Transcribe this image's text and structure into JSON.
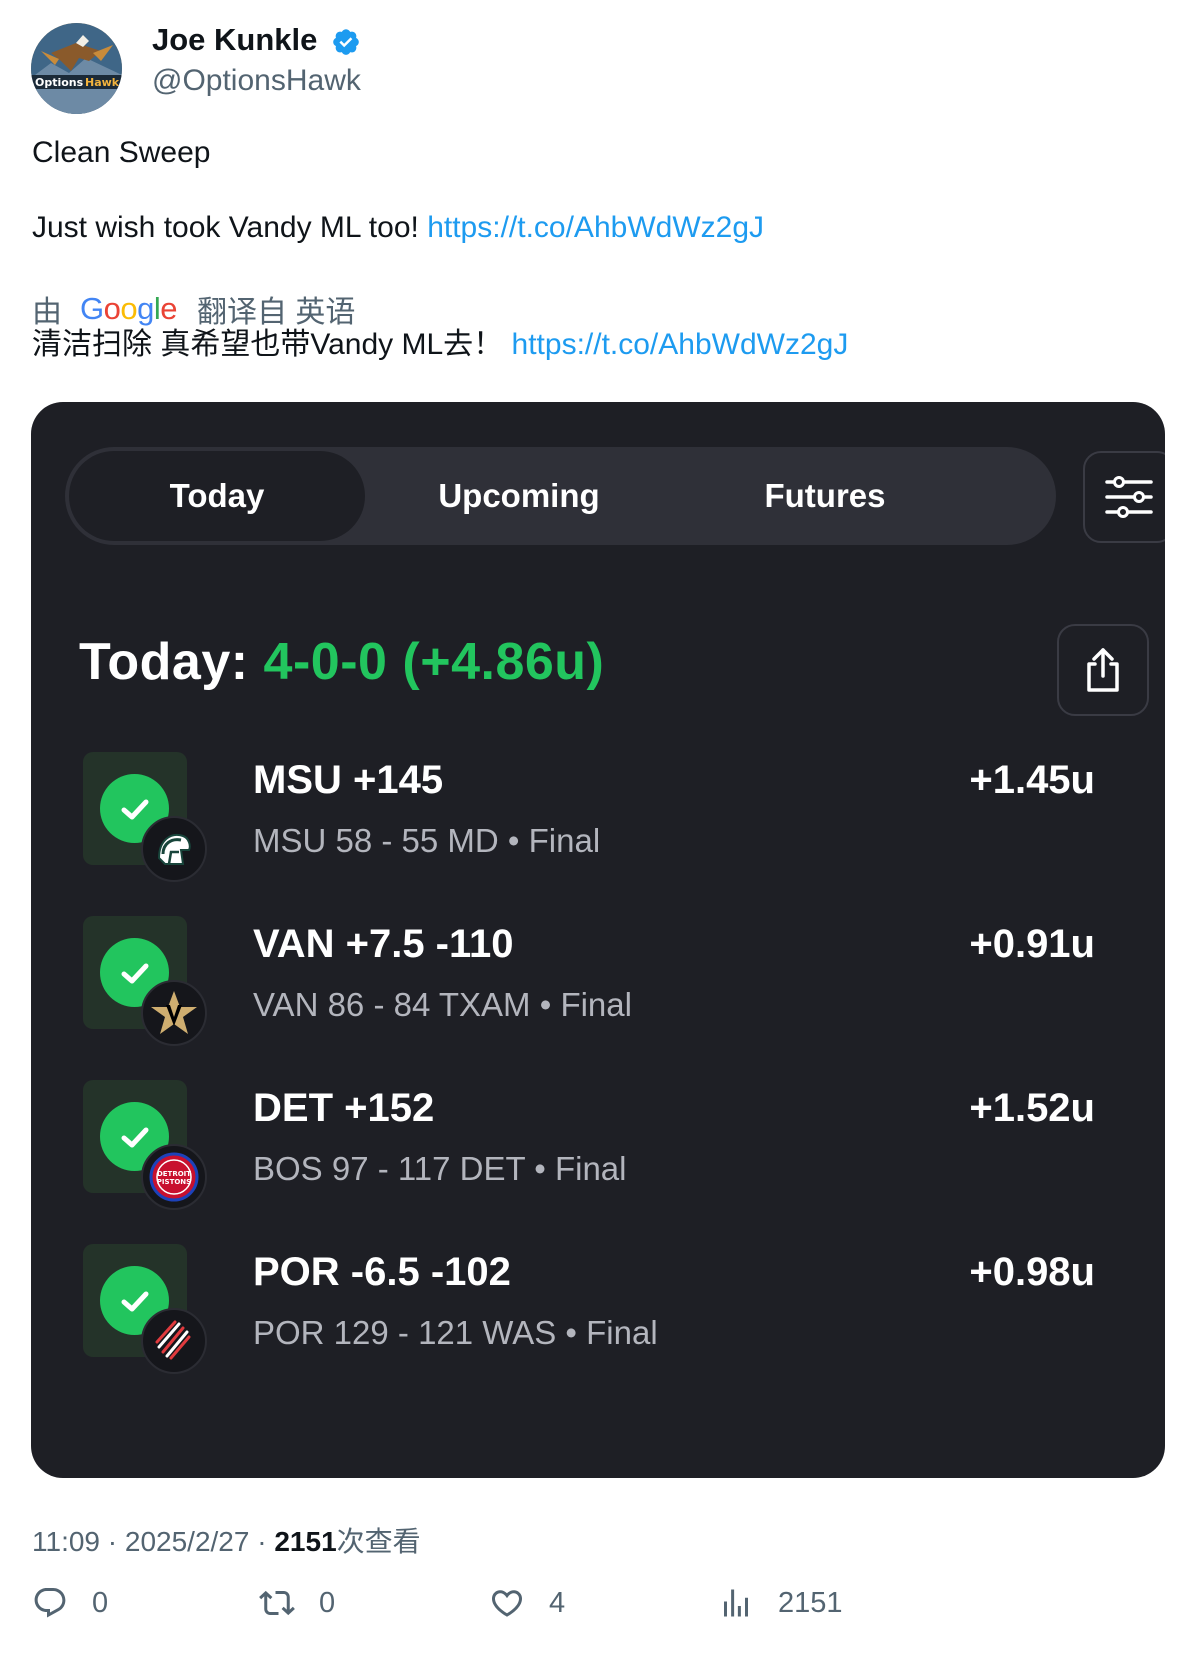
{
  "author": {
    "name": "Joe Kunkle",
    "handle": "@OptionsHawk",
    "avatar_text": "OptionsHawk"
  },
  "tweet": {
    "line1": "Clean Sweep",
    "line2": "Just wish took Vandy ML too!",
    "link": "https://t.co/AhbWdWz2gJ"
  },
  "translation": {
    "prefix": "由",
    "provider": "Google",
    "suffix": "翻译自 英语",
    "text": "清洁扫除 真希望也带Vandy ML去！",
    "link": "https://t.co/AhbWdWz2gJ"
  },
  "app": {
    "tabs": [
      "Today",
      "Upcoming",
      "Futures"
    ],
    "active_tab": "Today",
    "summary_label": "Today:",
    "summary_record": "4-0-0 (+4.86u)",
    "bets": [
      {
        "title": "MSU +145",
        "subtitle": "MSU 58 - 55 MD • Final",
        "profit": "+1.45u",
        "logo": "spartan-helmet-icon"
      },
      {
        "title": "VAN +7.5 -110",
        "subtitle": "VAN 86 - 84 TXAM • Final",
        "profit": "+0.91u",
        "logo": "vanderbilt-star-v-icon"
      },
      {
        "title": "DET +152",
        "subtitle": "BOS 97 - 117 DET • Final",
        "profit": "+1.52u",
        "logo": "pistons-logo-icon"
      },
      {
        "title": "POR -6.5 -102",
        "subtitle": "POR 129 - 121 WAS • Final",
        "profit": "+0.98u",
        "logo": "blazers-pinwheel-icon"
      }
    ],
    "colors": {
      "accent_green": "#22c55e",
      "card_bg": "#1e1f25"
    }
  },
  "pistons_logo_text": {
    "line1": "DETROIT",
    "line2": "PISTONS"
  },
  "meta": {
    "time": "11:09",
    "date": "2025/2/27",
    "views": "2151",
    "views_label": "次查看"
  },
  "actions": {
    "replies": "0",
    "retweets": "0",
    "likes": "4",
    "views": "2151"
  },
  "colors": {
    "link": "#1d9bf0",
    "muted": "#536471",
    "verified": "#1d9bf0"
  }
}
